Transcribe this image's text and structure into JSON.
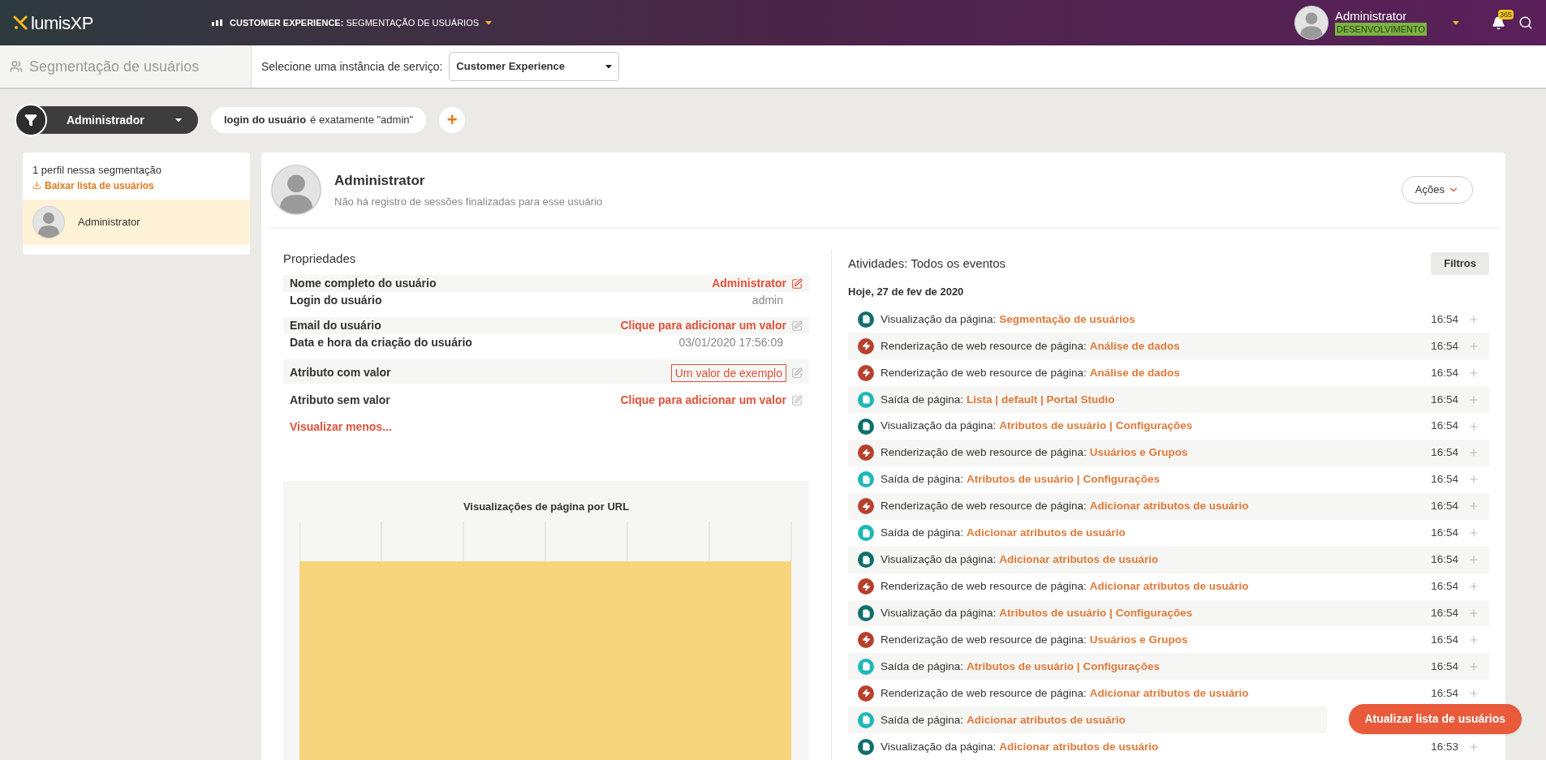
{
  "top_bar": {
    "logo": "lumis**XP**",
    "context_selector": "**CUSTOMER EXPERIENCE:** SEGMENTAÇÃO DE USUÁRIOS",
    "user": {
      "name": "Administrator",
      "environment": "DESENVOLVIMENTO"
    },
    "notifications": {
      "count": "365"
    }
  },
  "sub_bar": {
    "title": "Segmentação de usuários",
    "instance_label": "Selecione uma instância de serviço:",
    "instance_value": "Customer Experience"
  },
  "filter_bar": {
    "segment": "Administrador",
    "condition": {
      "field": "login do usuário",
      "rule": "é exatamente \"admin\""
    },
    "add": "+"
  },
  "sidebar": {
    "count": "1 perfil nessa segmentação",
    "download": "Baixar lista de usuários",
    "items": [
      {
        "name": "Administrator",
        "selected": true
      }
    ]
  },
  "profile": {
    "name": "Administrator",
    "subtitle": "Não há registro de sessões finalizadas para esse usuário",
    "actions": "Ações"
  },
  "properties": {
    "title": "Propriedades",
    "rows": [
      {
        "label": "Nome completo do usuário",
        "value": "Administrator",
        "kind": "link"
      },
      {
        "label": "Login do usuário",
        "value": "admin",
        "kind": "plain"
      },
      {
        "label": "Email do usuário",
        "value": "Clique para adicionar um valor",
        "kind": "empty"
      },
      {
        "label": "Data e hora da criação do usuário",
        "value": "03/01/2020 17:56:09",
        "kind": "plain"
      },
      {
        "label": "Atributo com valor",
        "value": "Um valor de exemplo",
        "kind": "boxed"
      },
      {
        "label": "Atributo sem valor",
        "value": "Clique para adicionar um valor",
        "kind": "empty"
      }
    ],
    "toggle": "Visualizar menos..."
  },
  "chart": {
    "title": "Visualizações de página por URL"
  },
  "activities": {
    "title": "Atividades: Todos os eventos",
    "filters": "Filtros",
    "date": "Hoje, 27 de fev de 2020",
    "items": [
      {
        "kind": "view",
        "action": "Visualização da página:",
        "target": "Segmentação de usuários",
        "time": "16:54"
      },
      {
        "kind": "render",
        "action": "Renderização de web resource de página:",
        "target": "Análise de dados",
        "time": "16:54"
      },
      {
        "kind": "render",
        "action": "Renderização de web resource de página:",
        "target": "Análise de dados",
        "time": "16:54"
      },
      {
        "kind": "exit",
        "action": "Saída de página:",
        "target": "Lista | default | Portal Studio",
        "time": "16:54"
      },
      {
        "kind": "view",
        "action": "Visualização da página:",
        "target": "Atributos de usuário | Configurações",
        "time": "16:54"
      },
      {
        "kind": "render",
        "action": "Renderização de web resource de página:",
        "target": "Usuários e Grupos",
        "time": "16:54"
      },
      {
        "kind": "exit",
        "action": "Saída de página:",
        "target": "Atributos de usuário | Configurações",
        "time": "16:54"
      },
      {
        "kind": "render",
        "action": "Renderização de web resource de página:",
        "target": "Adicionar atributos de usuário",
        "time": "16:54"
      },
      {
        "kind": "exit",
        "action": "Saída de página:",
        "target": "Adicionar atributos de usuário",
        "time": "16:54"
      },
      {
        "kind": "view",
        "action": "Visualização da página:",
        "target": "Adicionar atributos de usuário",
        "time": "16:54"
      },
      {
        "kind": "render",
        "action": "Renderização de web resource de página:",
        "target": "Adicionar atributos de usuário",
        "time": "16:54"
      },
      {
        "kind": "view",
        "action": "Visualização da página:",
        "target": "Atributos de usuário | Configurações",
        "time": "16:54"
      },
      {
        "kind": "render",
        "action": "Renderização de web resource de página:",
        "target": "Usuários e Grupos",
        "time": "16:54"
      },
      {
        "kind": "exit",
        "action": "Saída de página:",
        "target": "Atributos de usuário | Configurações",
        "time": "16:54"
      },
      {
        "kind": "render",
        "action": "Renderização de web resource de página:",
        "target": "Adicionar atributos de usuário",
        "time": "16:54"
      },
      {
        "kind": "exit",
        "action": "Saída de página:",
        "target": "Adicionar atributos de usuário"
      },
      {
        "kind": "view",
        "action": "Visualização da página:",
        "target": "Adicionar atributos de usuário",
        "time": "16:53"
      }
    ]
  },
  "refresh_button": "Atualizar lista de usuários"
}
